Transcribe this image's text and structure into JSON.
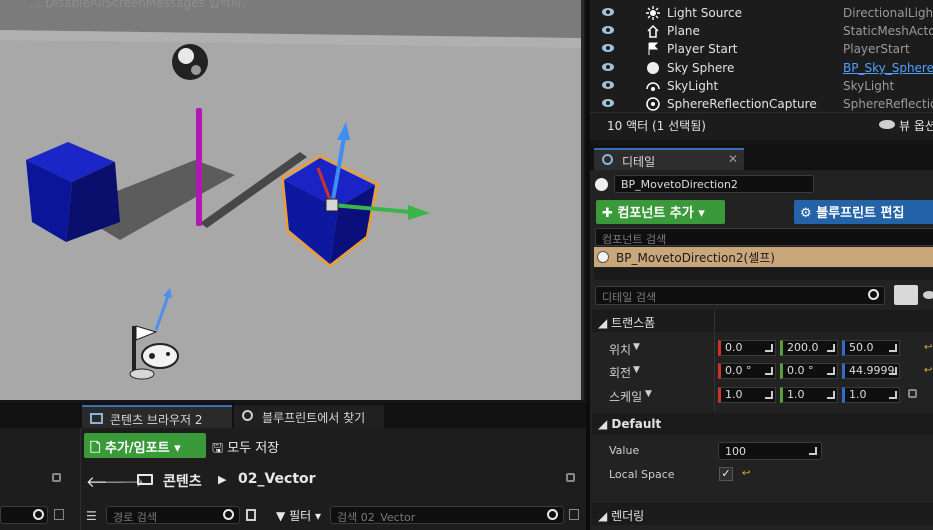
{
  "viewport": {
    "message": "... DisableAllScreenMessages 입력하."
  },
  "outliner": {
    "rows": [
      {
        "name": "Light Source",
        "type": "DirectionalLight",
        "icon": "light-source-icon"
      },
      {
        "name": "Plane",
        "type": "StaticMeshActor",
        "icon": "plane-icon"
      },
      {
        "name": "Player Start",
        "type": "PlayerStart",
        "icon": "player-start-icon"
      },
      {
        "name": "Sky Sphere",
        "type": "BP_Sky_Sphere",
        "icon": "sky-sphere-icon",
        "type_link": true
      },
      {
        "name": "SkyLight",
        "type": "SkyLight",
        "icon": "skylight-icon"
      },
      {
        "name": "SphereReflectionCapture",
        "type": "SphereReflection",
        "icon": "reflection-capture-icon"
      }
    ],
    "footer_count": "10 액터 (1 선택됨)",
    "view_options": "뷰 옵션"
  },
  "details": {
    "tab": "디테일",
    "actor_name": "BP_MovetoDirection2",
    "add_component": "컴포넌트 추가",
    "edit_blueprint": "블루프린트 편집",
    "component_search_placeholder": "컴포넌트 검색",
    "component_self": "BP_MovetoDirection2(셀프)",
    "details_search_placeholder": "디테일 검색",
    "categories": {
      "transform": "트랜스폼",
      "default": "Default",
      "rendering": "렌더링"
    },
    "transform": {
      "location_label": "위치",
      "rotation_label": "회전",
      "scale_label": "스케일",
      "location": [
        "0.0",
        "200.0",
        "50.0"
      ],
      "rotation": [
        "0.0 °",
        "0.0 °",
        "44.9999"
      ],
      "scale": [
        "1.0",
        "1.0",
        "1.0"
      ]
    },
    "default": {
      "value_label": "Value",
      "value": "100",
      "local_space_label": "Local Space",
      "local_space_checked": true
    }
  },
  "content_browser": {
    "tabs": [
      "콘텐츠 브라우저 2",
      "블루프린트에서 찾기"
    ],
    "add_import": "추가/임포트",
    "save_all": "모두 저장",
    "path": [
      "콘텐츠",
      "02_Vector"
    ],
    "path_search_placeholder": "경로 검색",
    "filter_label": "필터",
    "asset_search_placeholder": "검색 02_Vector"
  },
  "colors": {
    "accent_blue": "#3a6fb5",
    "green_button": "#3a9a3a",
    "blue_button": "#2563a8",
    "selected_row": "#c9a77a",
    "link": "#4ea1ff"
  }
}
